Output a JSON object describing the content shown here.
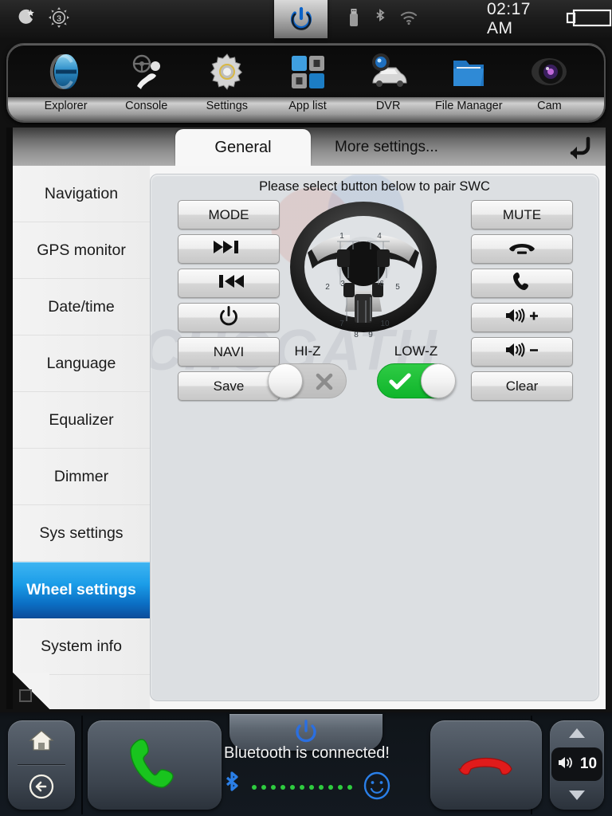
{
  "statusbar": {
    "night_icon": "moon-star-icon",
    "brightness_icon": "brightness-sun-icon",
    "brightness_level": "3",
    "power_icon": "power-icon",
    "usb_icon": "usb-drive-icon",
    "bluetooth_icon": "bluetooth-icon",
    "wifi_icon": "wifi-icon",
    "time": "02:17 AM",
    "battery_icon": "battery-icon"
  },
  "dock": {
    "items": [
      {
        "label": "Explorer",
        "icon": "explorer-e-icon"
      },
      {
        "label": "Console",
        "icon": "console-steering-icon"
      },
      {
        "label": "Settings",
        "icon": "gear-icon"
      },
      {
        "label": "App list",
        "icon": "app-grid-icon"
      },
      {
        "label": "DVR",
        "icon": "dvr-car-camera-icon"
      },
      {
        "label": "File Manager",
        "icon": "folder-icon"
      },
      {
        "label": "Cam",
        "icon": "camera-lens-icon"
      }
    ]
  },
  "tabs": {
    "general": "General",
    "more_settings": "More settings...",
    "back_icon": "back-arrow-icon",
    "active": "General"
  },
  "sidebar": {
    "items": [
      {
        "label": "Navigation",
        "active": false
      },
      {
        "label": "GPS monitor",
        "active": false
      },
      {
        "label": "Date/time",
        "active": false
      },
      {
        "label": "Language",
        "active": false
      },
      {
        "label": "Equalizer",
        "active": false
      },
      {
        "label": "Dimmer",
        "active": false
      },
      {
        "label": "Sys settings",
        "active": false
      },
      {
        "label": "Wheel settings",
        "active": true
      },
      {
        "label": "System info",
        "active": false
      }
    ],
    "active_color": "#1b9de8"
  },
  "content": {
    "prompt": "Please select button below to pair SWC",
    "watermark": "CHOGATH",
    "left_buttons": [
      {
        "label": "MODE",
        "icon": ""
      },
      {
        "label": "",
        "icon": "next-track-icon"
      },
      {
        "label": "",
        "icon": "prev-track-icon"
      },
      {
        "label": "",
        "icon": "power-icon"
      },
      {
        "label": "NAVI",
        "icon": ""
      },
      {
        "label": "Save",
        "icon": ""
      }
    ],
    "right_buttons": [
      {
        "label": "MUTE",
        "icon": ""
      },
      {
        "label": "",
        "icon": "hang-up-icon"
      },
      {
        "label": "",
        "icon": "answer-call-icon"
      },
      {
        "label": "",
        "icon": "volume-up-icon"
      },
      {
        "label": "",
        "icon": "volume-down-icon"
      },
      {
        "label": "Clear",
        "icon": ""
      }
    ],
    "wheel": {
      "icon": "steering-wheel-diagram",
      "button_numbers": [
        "1",
        "2",
        "3",
        "4",
        "5",
        "6",
        "7",
        "8",
        "9",
        "10"
      ]
    },
    "toggles": [
      {
        "name": "HI-Z",
        "label": "HI-Z",
        "state": "off",
        "glyph": "cross-icon",
        "color": "#bdbdbd"
      },
      {
        "name": "LOW-Z",
        "label": "LOW-Z",
        "state": "on",
        "glyph": "check-icon",
        "color": "#0fb52b"
      }
    ]
  },
  "bottombar": {
    "home_icon": "home-icon",
    "back_icon": "back-circle-icon",
    "call_icon": "answer-call-icon",
    "power_icon": "power-icon",
    "endcall_icon": "end-call-icon",
    "bluetooth_status": "Bluetooth is connected!",
    "bluetooth_icon": "bluetooth-icon",
    "smiley_icon": "smiley-icon",
    "volume_value": "10",
    "volume_icon": "volume-icon",
    "vol_up_icon": "chevron-up-icon",
    "vol_down_icon": "chevron-down-icon",
    "dot_count": 11
  }
}
